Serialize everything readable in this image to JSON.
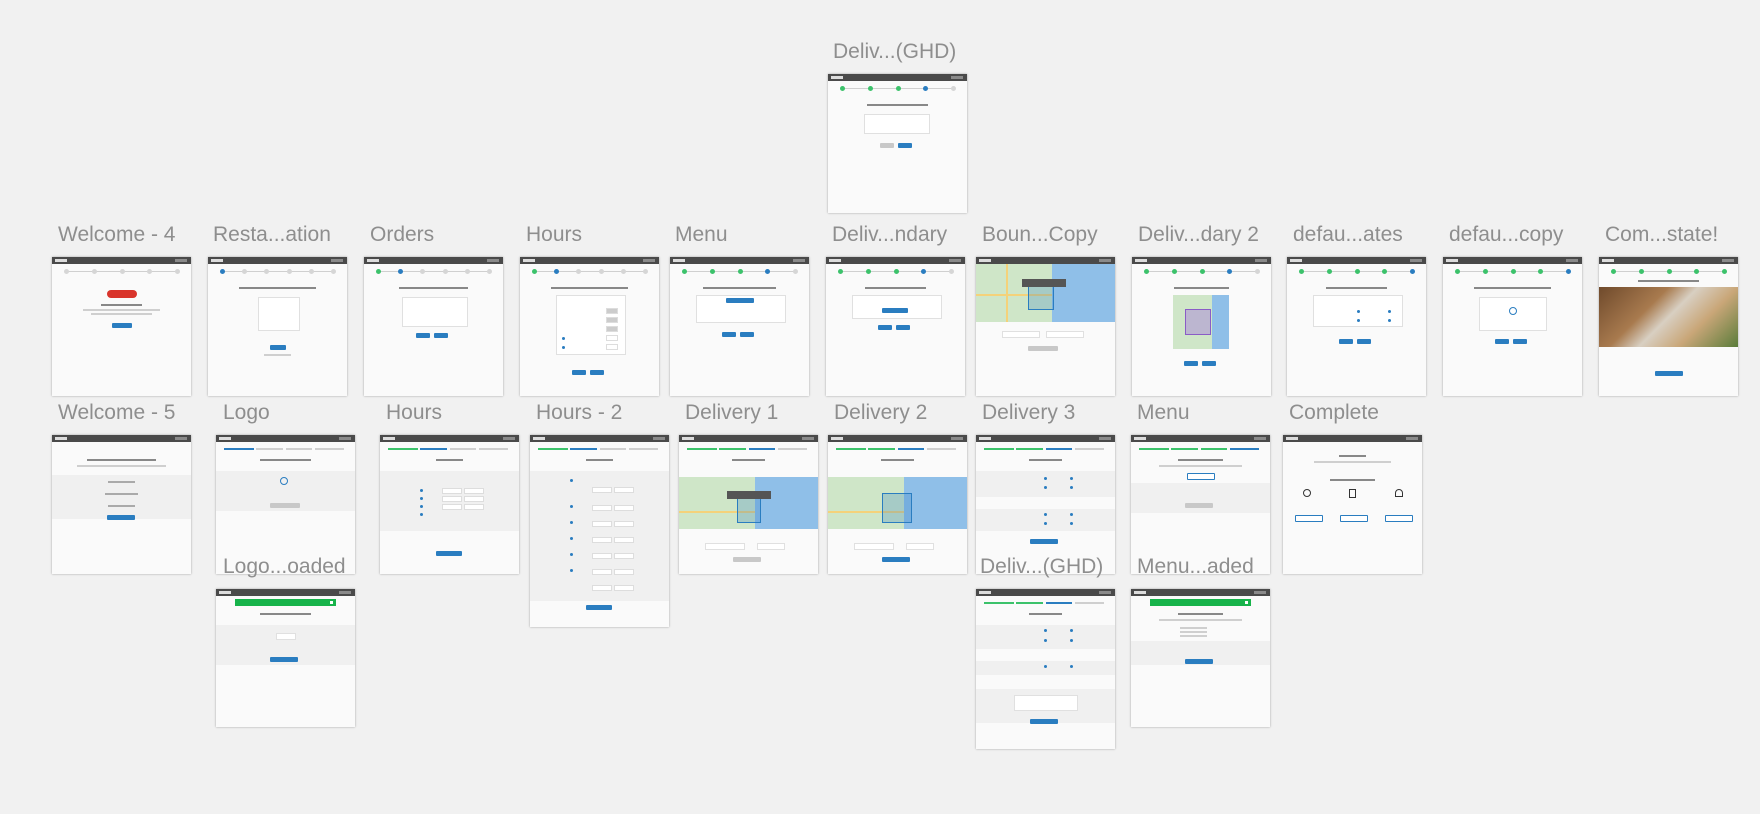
{
  "colors": {
    "canvas": "#f1f1f1",
    "label": "#8e8e8e",
    "header": "#4a4a4a",
    "accent_blue": "#2a7dc0",
    "step_green": "#3cc26b",
    "banner_green": "#17b34a",
    "brand_red": "#d9342b"
  },
  "artboards": [
    {
      "key": "top",
      "label": "Deliv...(GHD)",
      "kind": "delivery-ghd-steps"
    },
    {
      "key": "r1_1",
      "label": "Welcome - 4",
      "kind": "welcome"
    },
    {
      "key": "r1_2",
      "label": "Resta...ation",
      "kind": "restaurant"
    },
    {
      "key": "r1_3",
      "label": "Orders",
      "kind": "orders"
    },
    {
      "key": "r1_4",
      "label": "Hours",
      "kind": "hours-grid"
    },
    {
      "key": "r1_5",
      "label": "Menu",
      "kind": "menu-upload"
    },
    {
      "key": "r1_6",
      "label": "Deliv...ndary",
      "kind": "delivery-boundary"
    },
    {
      "key": "r1_7",
      "label": "Boun...Copy",
      "kind": "boundary-map"
    },
    {
      "key": "r1_8",
      "label": "Deliv...dary 2",
      "kind": "delivery-purple"
    },
    {
      "key": "r1_9",
      "label": "defau...ates",
      "kind": "default-rates"
    },
    {
      "key": "r1_10",
      "label": "defau...copy",
      "kind": "default-copy"
    },
    {
      "key": "r1_11",
      "label": "Com...state!",
      "kind": "complete-photo"
    },
    {
      "key": "r2_1",
      "label": "Welcome - 5",
      "kind": "welcome5"
    },
    {
      "key": "r2_2",
      "label": "Logo",
      "kind": "logo"
    },
    {
      "key": "r2_3",
      "label": "Hours",
      "kind": "hours-tabs"
    },
    {
      "key": "r2_4",
      "label": "Hours - 2",
      "kind": "hours-tall"
    },
    {
      "key": "r2_5",
      "label": "Delivery 1",
      "kind": "delivery-map"
    },
    {
      "key": "r2_6",
      "label": "Delivery 2",
      "kind": "delivery-map2"
    },
    {
      "key": "r2_7",
      "label": "Delivery 3",
      "kind": "delivery-form"
    },
    {
      "key": "r2_8",
      "label": "Menu",
      "kind": "menu-tabs"
    },
    {
      "key": "r2_9",
      "label": "Complete",
      "kind": "complete"
    },
    {
      "key": "r3_1",
      "label": "Logo...oaded",
      "kind": "logo-uploaded"
    },
    {
      "key": "r3_2",
      "label": "Deliv...(GHD)",
      "kind": "delivery-ghd-tall"
    },
    {
      "key": "r3_3",
      "label": "Menu...aded",
      "kind": "menu-uploaded"
    }
  ],
  "icons": {
    "account_menu": "user-caret-icon",
    "map_zoom": "plus-minus-icon",
    "upload": "upload-icon",
    "close": "close-icon"
  }
}
